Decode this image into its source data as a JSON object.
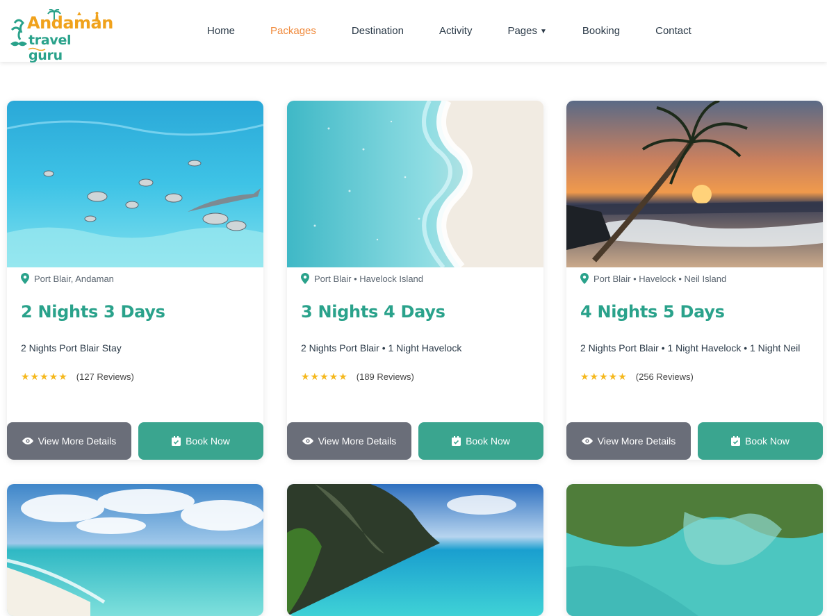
{
  "brand": {
    "line1": "Andaman",
    "line2": "travel guru"
  },
  "nav": {
    "items": [
      {
        "label": "Home",
        "active": false
      },
      {
        "label": "Packages",
        "active": true
      },
      {
        "label": "Destination",
        "active": false
      },
      {
        "label": "Activity",
        "active": false
      },
      {
        "label": "Pages",
        "active": false,
        "has_dropdown": true
      },
      {
        "label": "Booking",
        "active": false
      },
      {
        "label": "Contact",
        "active": false
      }
    ]
  },
  "packages": [
    {
      "image": "underwater-fish-scene",
      "location": "Port Blair, Andaman",
      "title": "2 Nights 3 Days",
      "description": "2 Nights Port Blair Stay",
      "rating_stars": 5,
      "reviews": "(127 Reviews)",
      "view_label": "View More Details",
      "book_label": "Book Now"
    },
    {
      "image": "sea-foam-shoreline",
      "location": "Port Blair • Havelock Island",
      "title": "3 Nights 4 Days",
      "description": "2 Nights Port Blair • 1 Night Havelock",
      "rating_stars": 5,
      "reviews": "(189 Reviews)",
      "view_label": "View More Details",
      "book_label": "Book Now"
    },
    {
      "image": "palm-sunset-beach",
      "location": "Port Blair • Havelock • Neil Island",
      "title": "4 Nights 5 Days",
      "description": "2 Nights Port Blair • 1 Night Havelock • 1 Night Neil",
      "rating_stars": 5,
      "reviews": "(256 Reviews)",
      "view_label": "View More Details",
      "book_label": "Book Now"
    }
  ],
  "packages_row2": [
    {
      "image": "white-sand-beach-sky"
    },
    {
      "image": "cliff-lagoon"
    },
    {
      "image": "aerial-turquoise-reef"
    }
  ],
  "colors": {
    "accent_teal": "#2aa28b",
    "accent_orange": "#f08a3c",
    "star": "#f5b81c",
    "button_gray": "#6a6e79",
    "button_teal": "#3aa58f"
  }
}
